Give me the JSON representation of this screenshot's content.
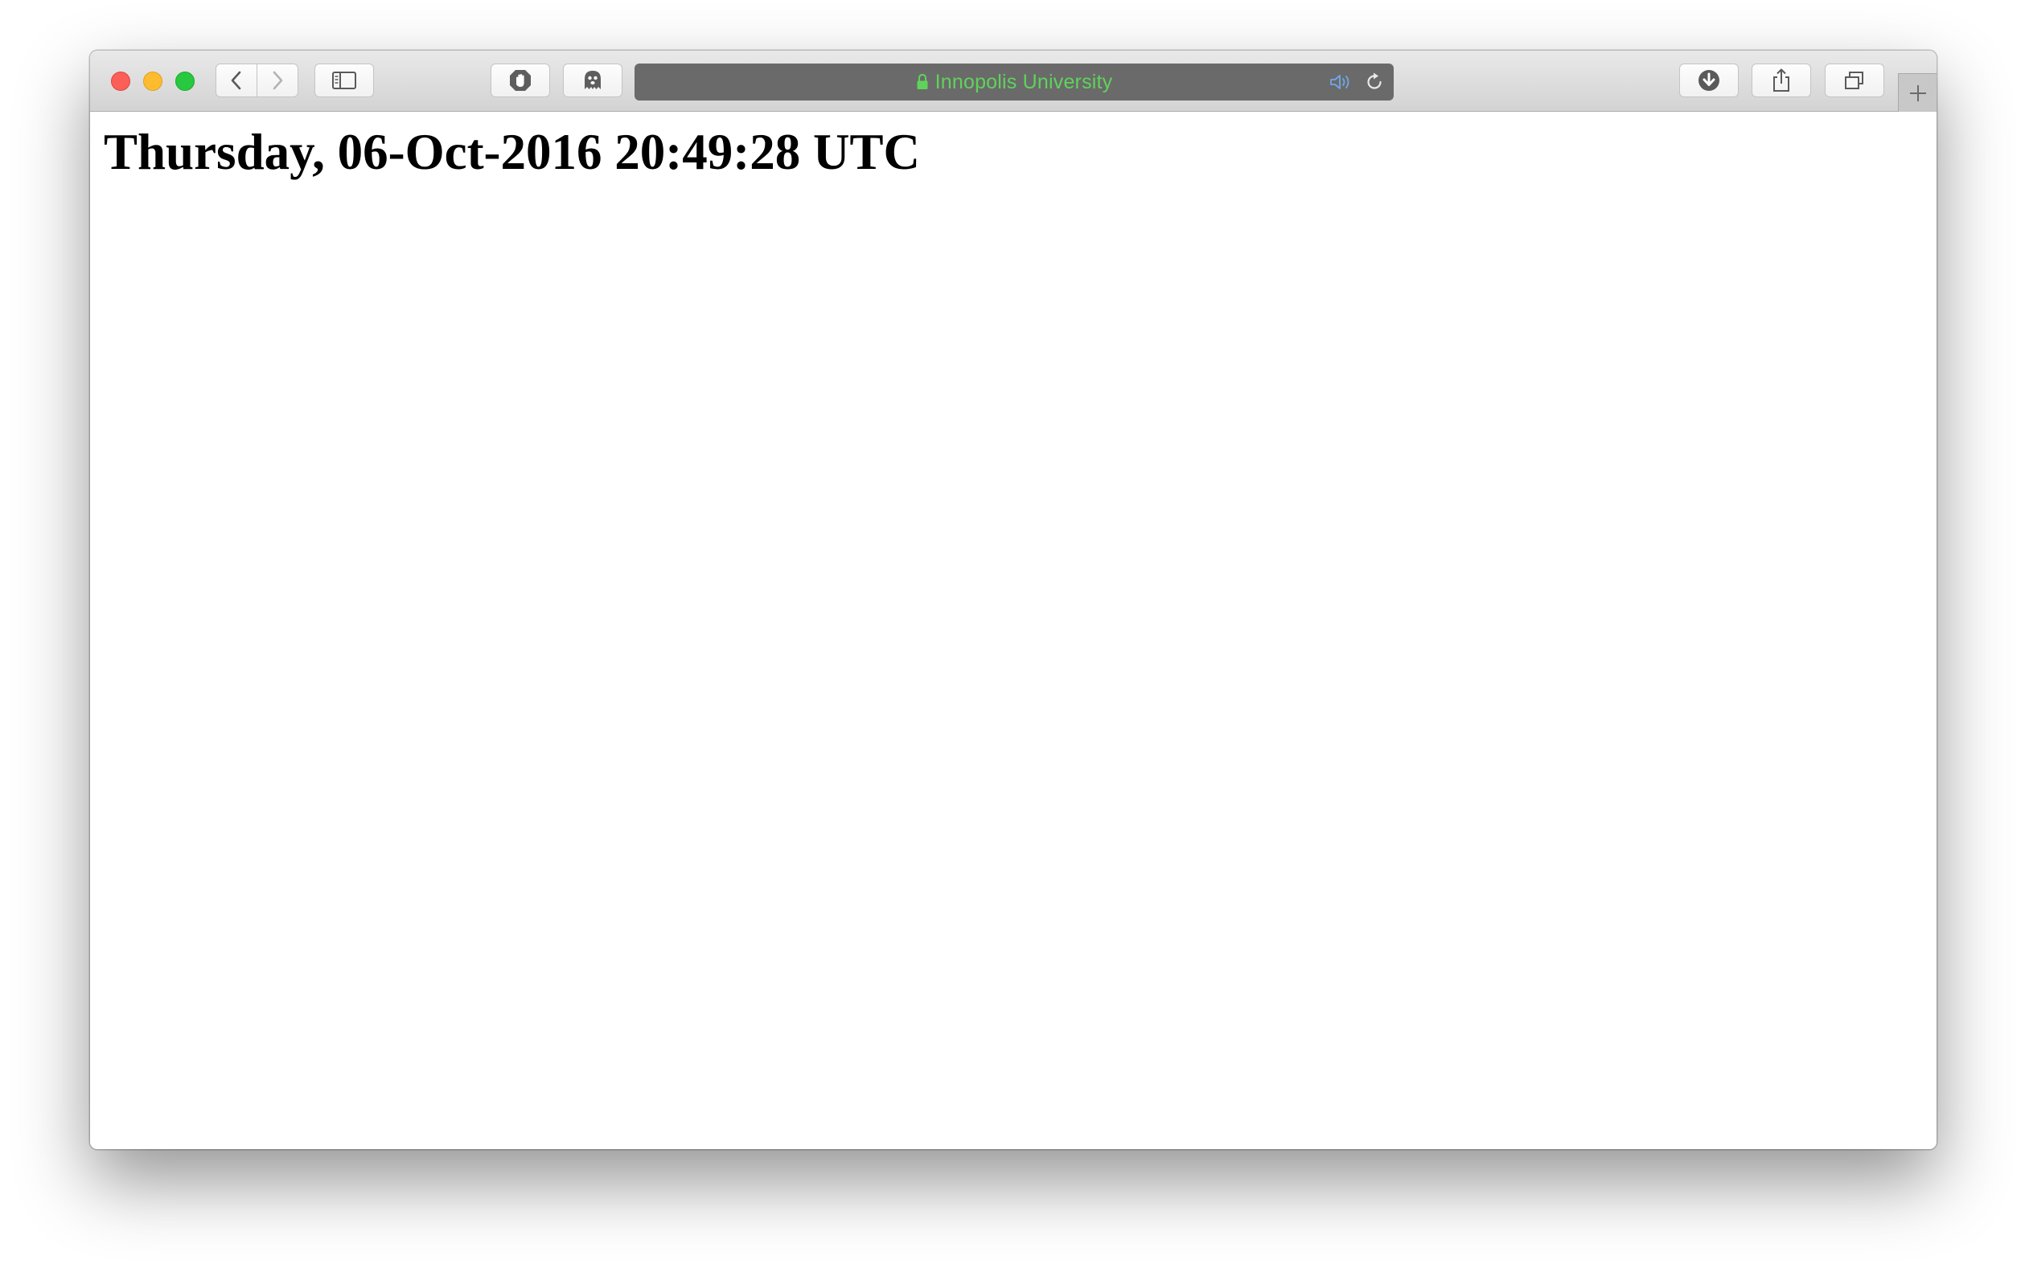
{
  "browser": {
    "address_bar": {
      "text": "Innopolis University",
      "secure": true
    },
    "icons": {
      "back": "chevron-left-icon",
      "forward": "chevron-right-icon",
      "sidebar": "sidebar-icon",
      "extension_1": "adblock-stop-icon",
      "extension_2": "ghost-icon",
      "audio": "speaker-icon",
      "reload": "reload-icon",
      "downloads": "download-icon",
      "share": "share-icon",
      "tabs": "tabs-overview-icon",
      "new_tab": "plus-icon"
    },
    "colors": {
      "address_bg": "#6a6a6a",
      "secure_text": "#5fd35b",
      "audio_icon": "#6fa8e8"
    }
  },
  "page": {
    "heading": "Thursday, 06-Oct-2016 20:49:28 UTC"
  }
}
